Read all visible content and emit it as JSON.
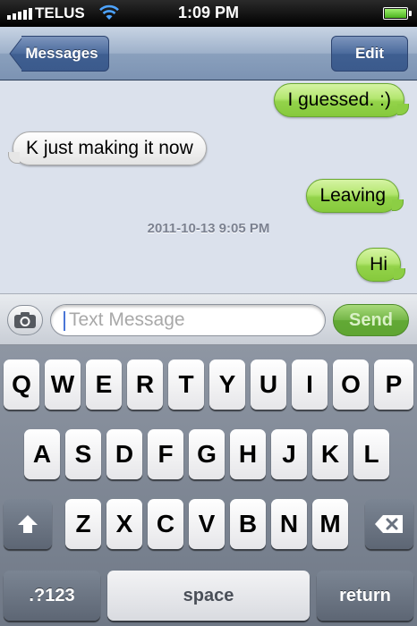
{
  "status_bar": {
    "carrier": "TELUS",
    "time": "1:09 PM",
    "signal_icon": "signal-bars-icon",
    "wifi_icon": "wifi-icon",
    "battery_icon": "battery-icon",
    "battery_level": 1.0
  },
  "nav": {
    "back_label": "Messages",
    "edit_label": "Edit"
  },
  "conversation": {
    "messages": [
      {
        "text": "I guessed. :)",
        "direction": "outgoing"
      },
      {
        "text": "K just making it now",
        "direction": "incoming"
      },
      {
        "text": "Leaving",
        "direction": "outgoing"
      },
      {
        "text": "Hi",
        "direction": "outgoing"
      }
    ],
    "timestamp": "2011-10-13 9:05 PM"
  },
  "input_bar": {
    "camera_icon": "camera-icon",
    "placeholder": "Text Message",
    "value": "",
    "send_label": "Send"
  },
  "keyboard": {
    "row1": [
      "Q",
      "W",
      "E",
      "R",
      "T",
      "Y",
      "U",
      "I",
      "O",
      "P"
    ],
    "row2": [
      "A",
      "S",
      "D",
      "F",
      "G",
      "H",
      "J",
      "K",
      "L"
    ],
    "row3": [
      "Z",
      "X",
      "C",
      "V",
      "B",
      "N",
      "M"
    ],
    "shift_icon": "shift-arrow-icon",
    "delete_icon": "backspace-icon",
    "numbers_label": ".?123",
    "space_label": "space",
    "return_label": "return"
  },
  "colors": {
    "outgoing_bubble": "#a6dd5e",
    "incoming_bubble": "#f0f0f0",
    "nav_button": "#4a6a9c",
    "send_button": "#6bb03c"
  }
}
